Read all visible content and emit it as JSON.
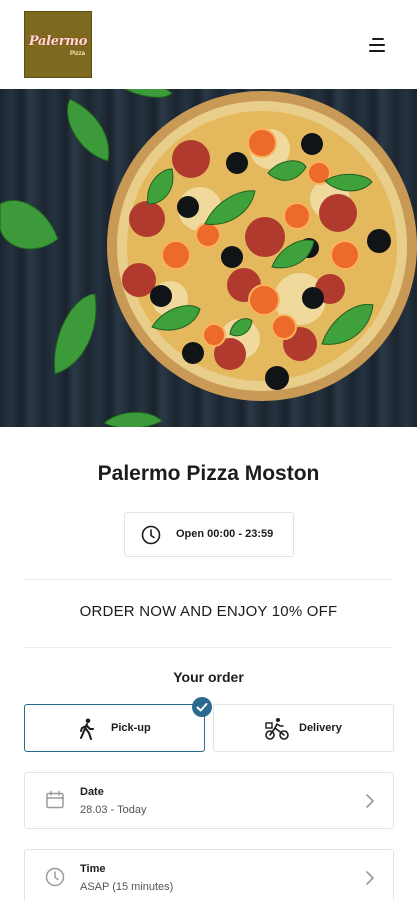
{
  "header": {
    "logo_text": "Palermo",
    "logo_subtext": "Pizza",
    "menu_icon": "hamburger-menu-icon"
  },
  "hero": {
    "image": "pizza-on-dark-wooden-table"
  },
  "restaurant": {
    "name": "Palermo Pizza Moston",
    "hours_icon": "clock-icon",
    "hours": "Open 00:00 - 23:59"
  },
  "promo": {
    "text": "ORDER NOW AND ENJOY 10% OFF"
  },
  "order": {
    "heading": "Your order",
    "options": [
      {
        "label": "Pick-up",
        "icon": "walking-person-icon",
        "selected": true
      },
      {
        "label": "Delivery",
        "icon": "bike-delivery-icon",
        "selected": false
      }
    ],
    "date": {
      "label": "Date",
      "value": "28.03 - Today",
      "icon": "calendar-icon"
    },
    "time": {
      "label": "Time",
      "value": "ASAP (15 minutes)",
      "icon": "clock-icon"
    }
  },
  "colors": {
    "accent": "#2a6a8e",
    "border": "#e3e3e3",
    "logo_bg": "#7d6a1f"
  }
}
